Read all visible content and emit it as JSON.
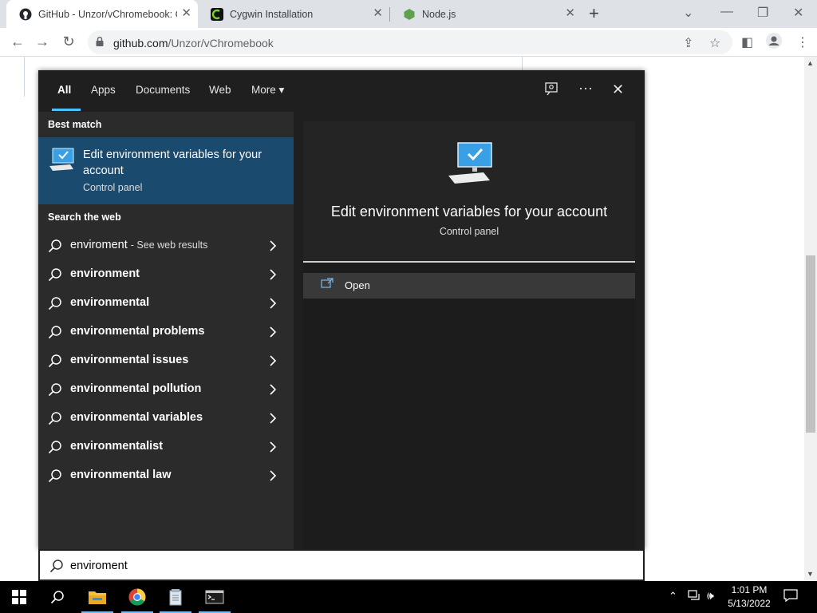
{
  "browser": {
    "tabs": [
      {
        "title": "GitHub - Unzor/vChromebook: C",
        "favicon": "github-icon",
        "active": true
      },
      {
        "title": "Cygwin Installation",
        "favicon": "cygwin-icon",
        "active": false
      },
      {
        "title": "Node.js",
        "favicon": "nodejs-icon",
        "active": false
      }
    ],
    "url_host": "github.com",
    "url_path": "/Unzor/vChromebook"
  },
  "search_panel": {
    "tabs": [
      "All",
      "Apps",
      "Documents",
      "Web",
      "More"
    ],
    "active_tab": "All",
    "best_match_heading": "Best match",
    "best_match": {
      "title": "Edit environment variables for your account",
      "subtitle": "Control panel",
      "icon": "computer-settings-icon"
    },
    "search_web_heading": "Search the web",
    "web_results": [
      {
        "text": "enviroment",
        "hint": "- See web results"
      },
      {
        "text": "environment"
      },
      {
        "text": "environmental"
      },
      {
        "text": "environmental problems"
      },
      {
        "text": "environmental issues"
      },
      {
        "text": "environmental pollution"
      },
      {
        "text": "environmental variables"
      },
      {
        "text": "environmentalist"
      },
      {
        "text": "environmental law"
      }
    ],
    "preview": {
      "title": "Edit environment variables for your account",
      "subtitle": "Control panel",
      "action_open": "Open"
    },
    "query": "enviroment"
  },
  "taskbar": {
    "apps": [
      "file-explorer-icon",
      "chrome-icon",
      "notepad-icon",
      "terminal-icon"
    ],
    "time": "1:01 PM",
    "date": "5/13/2022"
  },
  "colors": {
    "accent": "#4cc2ff",
    "best_match_bg": "#1a4a6e",
    "panel_bg": "#1f1f1f"
  }
}
